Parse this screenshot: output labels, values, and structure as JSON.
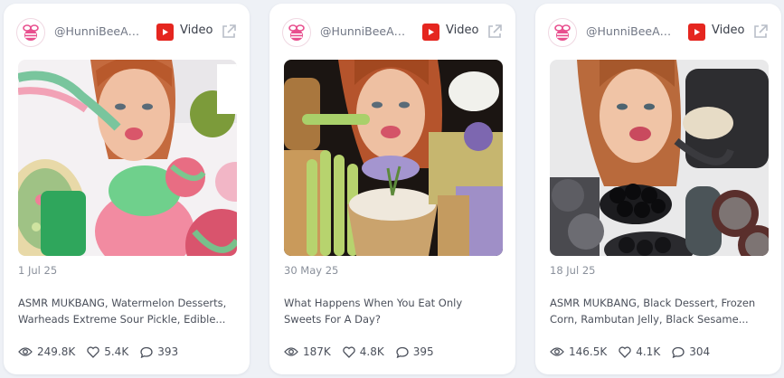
{
  "cards": [
    {
      "handle": "@HunniBeeAS...",
      "platform_label": "Video",
      "date": "1 Jul 25",
      "title": "ASMR MUKBANG, Watermelon Desserts, Warheads Extreme Sour Pickle, Edible...",
      "views": "249.8K",
      "likes": "5.4K",
      "comments": "393"
    },
    {
      "handle": "@HunniBeeAS...",
      "platform_label": "Video",
      "date": "30 May 25",
      "title": "What Happens When You Eat Only Sweets For A Day?",
      "views": "187K",
      "likes": "4.8K",
      "comments": "395"
    },
    {
      "handle": "@HunniBeeAS...",
      "platform_label": "Video",
      "date": "18 Jul 25",
      "title": "ASMR MUKBANG, Black Dessert, Frozen Corn, Rambutan Jelly, Black Sesame...",
      "views": "146.5K",
      "likes": "4.1K",
      "comments": "304"
    }
  ],
  "icons": {
    "avatar": "bee-logo-icon",
    "platform": "youtube-icon",
    "external": "external-link-icon",
    "views": "eye-icon",
    "likes": "heart-icon",
    "comments": "comment-icon"
  },
  "colors": {
    "youtube": "#e5261f",
    "brand_pink": "#e84f8e",
    "background": "#eef1f6"
  }
}
